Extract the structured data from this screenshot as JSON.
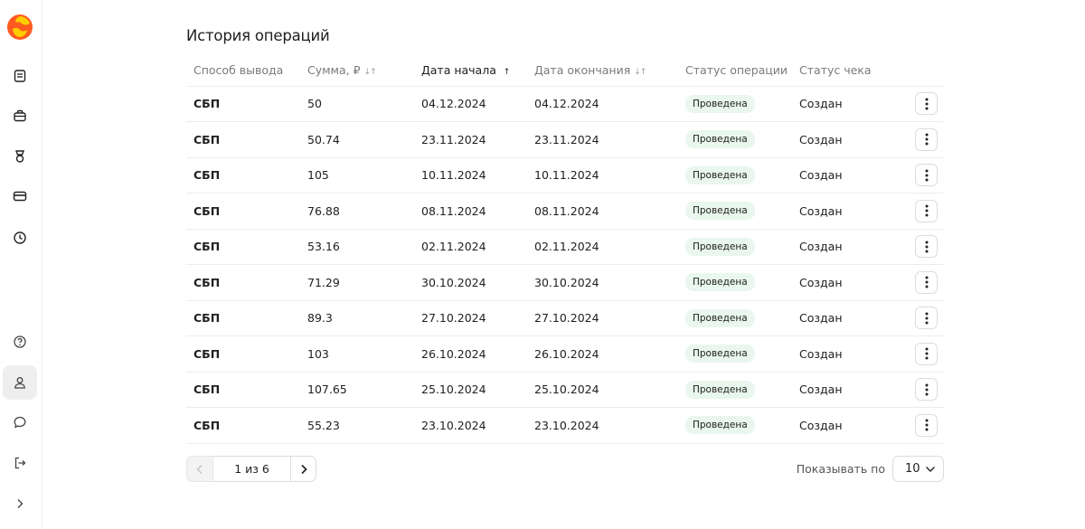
{
  "page": {
    "title": "История операций"
  },
  "table": {
    "headers": {
      "method": "Способ вывода",
      "amount": "Сумма, ₽",
      "start_date": "Дата начала",
      "end_date": "Дата окончания",
      "op_status": "Статус операции",
      "receipt_status": "Статус чека"
    },
    "rows": [
      {
        "method": "СБП",
        "amount": "50",
        "start": "04.12.2024",
        "end": "04.12.2024",
        "status": "Проведена",
        "receipt": "Создан"
      },
      {
        "method": "СБП",
        "amount": "50.74",
        "start": "23.11.2024",
        "end": "23.11.2024",
        "status": "Проведена",
        "receipt": "Создан"
      },
      {
        "method": "СБП",
        "amount": "105",
        "start": "10.11.2024",
        "end": "10.11.2024",
        "status": "Проведена",
        "receipt": "Создан"
      },
      {
        "method": "СБП",
        "amount": "76.88",
        "start": "08.11.2024",
        "end": "08.11.2024",
        "status": "Проведена",
        "receipt": "Создан"
      },
      {
        "method": "СБП",
        "amount": "53.16",
        "start": "02.11.2024",
        "end": "02.11.2024",
        "status": "Проведена",
        "receipt": "Создан"
      },
      {
        "method": "СБП",
        "amount": "71.29",
        "start": "30.10.2024",
        "end": "30.10.2024",
        "status": "Проведена",
        "receipt": "Создан"
      },
      {
        "method": "СБП",
        "amount": "89.3",
        "start": "27.10.2024",
        "end": "27.10.2024",
        "status": "Проведена",
        "receipt": "Создан"
      },
      {
        "method": "СБП",
        "amount": "103",
        "start": "26.10.2024",
        "end": "26.10.2024",
        "status": "Проведена",
        "receipt": "Создан"
      },
      {
        "method": "СБП",
        "amount": "107.65",
        "start": "25.10.2024",
        "end": "25.10.2024",
        "status": "Проведена",
        "receipt": "Создан"
      },
      {
        "method": "СБП",
        "amount": "55.23",
        "start": "23.10.2024",
        "end": "23.10.2024",
        "status": "Проведена",
        "receipt": "Создан"
      }
    ]
  },
  "pagination": {
    "page_label": "1 из 6"
  },
  "per_page": {
    "label": "Показывать по",
    "value": "10"
  },
  "sidebar": {
    "icons": [
      "logo-icon",
      "document-icon",
      "briefcase-icon",
      "medal-icon",
      "card-icon",
      "clock-icon",
      "help-icon",
      "profile-icon",
      "chat-icon",
      "logout-icon",
      "expand-icon"
    ]
  },
  "colors": {
    "status_badge_bg": "#e9f7ee",
    "sidebar_active_bg": "#eeeeee"
  }
}
